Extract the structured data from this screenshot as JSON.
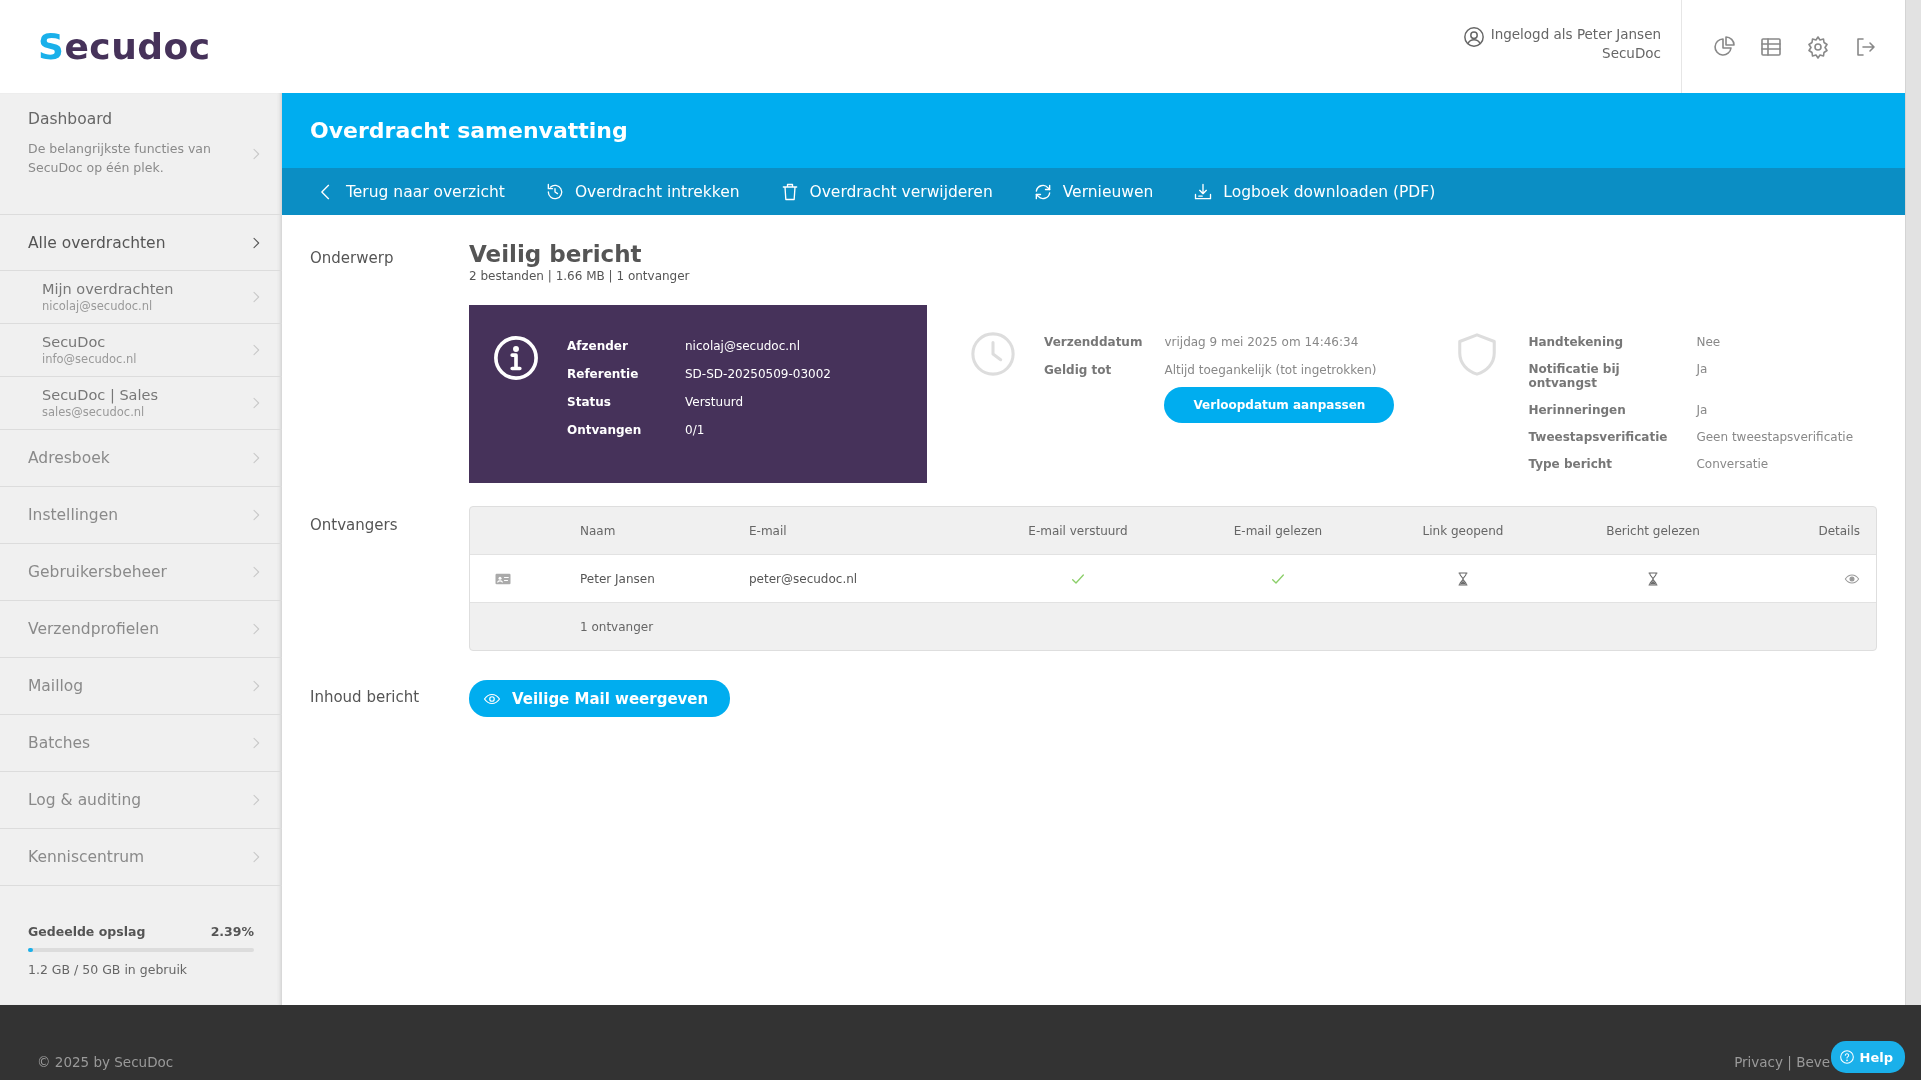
{
  "header": {
    "logo": "Secudoc",
    "user_line": "Ingelogd als Peter Jansen",
    "organisation": "SecuDoc"
  },
  "sidebar": {
    "items": [
      {
        "label": "Dashboard",
        "description": "De belangrijkste functies van SecuDoc op één plek.",
        "selected": false
      },
      {
        "label": "Alle overdrachten",
        "selected": true,
        "children": [
          {
            "label": "Mijn overdrachten",
            "email": "nicolaj@secudoc.nl"
          },
          {
            "label": "SecuDoc",
            "email": "info@secudoc.nl"
          },
          {
            "label": "SecuDoc | Sales",
            "email": "sales@secudoc.nl"
          }
        ]
      },
      {
        "label": "Adresboek",
        "selected": false
      },
      {
        "label": "Instellingen",
        "selected": false
      },
      {
        "label": "Gebruikersbeheer",
        "selected": false
      },
      {
        "label": "Verzendprofielen",
        "selected": false
      },
      {
        "label": "Maillog",
        "selected": false
      },
      {
        "label": "Batches",
        "selected": false
      },
      {
        "label": "Log & auditing",
        "selected": false
      },
      {
        "label": "Kenniscentrum",
        "selected": false
      }
    ],
    "storage": {
      "label": "Gedeelde opslag",
      "percent": "2.39%",
      "level": 0.024,
      "usage": "1.2 GB / 50 GB in gebruik"
    }
  },
  "page": {
    "title": "Overdracht samenvatting",
    "actions": [
      {
        "label": "Terug naar overzicht",
        "kind": "back"
      },
      {
        "label": "Overdracht intrekken",
        "kind": "revoke"
      },
      {
        "label": "Overdracht verwijderen",
        "kind": "delete"
      },
      {
        "label": "Vernieuwen",
        "kind": "refresh"
      },
      {
        "label": "Logboek downloaden (PDF)",
        "kind": "download"
      }
    ]
  },
  "subject": {
    "label": "Onderwerp",
    "title": "Veilig bericht",
    "meta": "2 bestanden | 1.66 MB | 1 ontvanger"
  },
  "info_card": {
    "rows": [
      {
        "label": "Afzender",
        "value": "nicolaj@secudoc.nl"
      },
      {
        "label": "Referentie",
        "value": "SD-SD-20250509-03002"
      },
      {
        "label": "Status",
        "value": "Verstuurd"
      },
      {
        "label": "Ontvangen",
        "value": "0/1"
      }
    ]
  },
  "dates": {
    "rows": [
      {
        "label": "Verzenddatum",
        "value": "vrijdag 9 mei 2025 om 14:46:34"
      },
      {
        "label": "Geldig tot",
        "value": "Altijd toegankelijk (tot ingetrokken)"
      }
    ],
    "button": "Verloopdatum aanpassen"
  },
  "options": {
    "rows": [
      {
        "label": "Handtekening",
        "value": "Nee"
      },
      {
        "label": "Notificatie bij ontvangst",
        "value": "Ja"
      },
      {
        "label": "Herinneringen",
        "value": "Ja"
      },
      {
        "label": "Tweestapsverificatie",
        "value": "Geen tweestapsverificatie"
      },
      {
        "label": "Type bericht",
        "value": "Conversatie"
      }
    ]
  },
  "recipients": {
    "label": "Ontvangers",
    "columns": [
      "Naam",
      "E-mail",
      "E-mail verstuurd",
      "E-mail gelezen",
      "Link geopend",
      "Bericht gelezen",
      "Details"
    ],
    "rows": [
      {
        "name": "Peter Jansen",
        "email": "peter@secudoc.nl",
        "email_sent": true,
        "email_read": true,
        "link_opened": false,
        "message_read": false
      }
    ],
    "footer": "1 ontvanger"
  },
  "content": {
    "label": "Inhoud bericht",
    "button": "Veilige Mail weergeven"
  },
  "footer": {
    "copyright": "© 2025 by SecuDoc",
    "links": "Privacy | Beve",
    "help": "Help"
  }
}
